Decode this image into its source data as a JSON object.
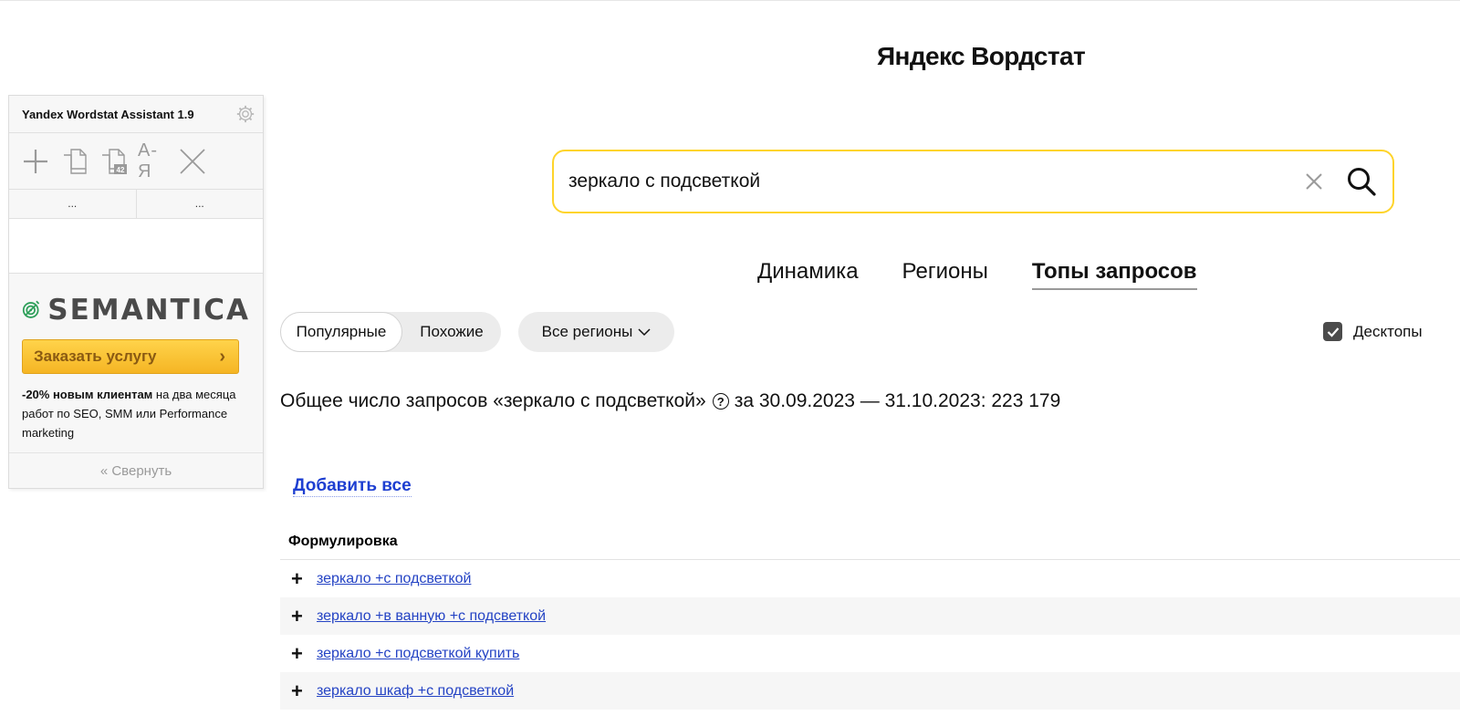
{
  "assistant": {
    "title": "Yandex Wordstat Assistant 1.9",
    "tab1": "...",
    "tab2": "...",
    "toolbar_az": "А-Я",
    "brand": "SEMANTICA",
    "order_button": "Заказать услугу",
    "promo_bold": "-20% новым клиентам",
    "promo_rest": " на два месяца работ по SEO, SMM или Performance marketing",
    "collapse": "« Свернуть"
  },
  "header": {
    "title": "Яндекс Вордстат"
  },
  "search": {
    "value": "зеркало с подсветкой"
  },
  "tabs": [
    {
      "label": "Динамика",
      "active": false
    },
    {
      "label": "Регионы",
      "active": false
    },
    {
      "label": "Топы запросов",
      "active": true
    }
  ],
  "filters": {
    "popular": "Популярные",
    "similar": "Похожие",
    "regions": "Все регионы",
    "desktop": "Десктопы",
    "desktop_checked": true
  },
  "summary": {
    "prefix": "Общее число запросов «зеркало с подсветкой»",
    "suffix": "за 30.09.2023 — 31.10.2023: 223 179"
  },
  "add_all": "Добавить все",
  "table": {
    "header": "Формулировка",
    "rows": [
      "зеркало +с подсветкой",
      "зеркало +в ванную +с подсветкой",
      "зеркало +с подсветкой купить",
      "зеркало шкаф +с подсветкой"
    ]
  },
  "colors": {
    "search_border": "#fed42b",
    "link": "#2443c4",
    "add_all": "#1e3fd1",
    "order_button": "#f5b524"
  }
}
